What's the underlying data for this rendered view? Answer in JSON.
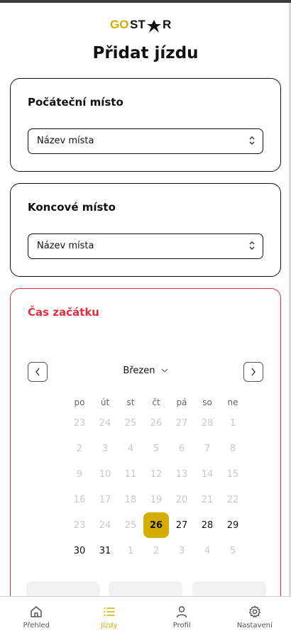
{
  "logo": {
    "part1": "GO",
    "part2": "ST",
    "part3": "R",
    "accent": "#d4ad00"
  },
  "page_title": "Přidat jízdu",
  "start_place": {
    "title": "Počáteční místo",
    "select_value": "Název místa"
  },
  "end_place": {
    "title": "Koncové místo",
    "select_value": "Název místa"
  },
  "start_time": {
    "title": "Čas začátku",
    "month": "Březen",
    "weekdays": [
      "po",
      "út",
      "st",
      "čt",
      "pá",
      "so",
      "ne"
    ],
    "weeks": [
      [
        "23",
        "24",
        "25",
        "26",
        "27",
        "28",
        "1"
      ],
      [
        "2",
        "3",
        "4",
        "5",
        "6",
        "7",
        "8"
      ],
      [
        "9",
        "10",
        "11",
        "12",
        "13",
        "14",
        "15"
      ],
      [
        "16",
        "17",
        "18",
        "19",
        "20",
        "21",
        "22"
      ],
      [
        "23",
        "24",
        "25",
        "26",
        "27",
        "28",
        "29"
      ],
      [
        "30",
        "31",
        "1",
        "2",
        "3",
        "4",
        "5"
      ]
    ],
    "selected_week": 4,
    "selected_day_index": 3
  },
  "bottom_nav": [
    {
      "label": "Přehled",
      "icon": "home-icon"
    },
    {
      "label": "Jízdy",
      "icon": "list-icon"
    },
    {
      "label": "Profil",
      "icon": "user-icon"
    },
    {
      "label": "Nastavení",
      "icon": "gear-icon"
    }
  ],
  "colors": {
    "accent": "#d4ad00",
    "danger": "#e0303f"
  }
}
